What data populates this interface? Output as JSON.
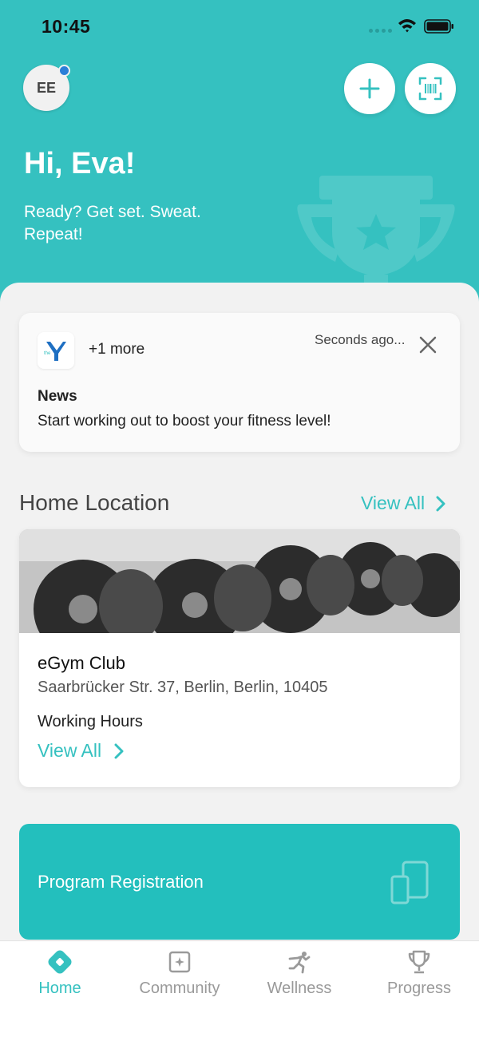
{
  "status_bar": {
    "time": "10:45"
  },
  "header": {
    "avatar_initials": "EE",
    "greeting": "Hi, Eva!",
    "tagline": "Ready? Get set. Sweat. Repeat!",
    "add_icon": "plus-icon",
    "scan_icon": "barcode-scan-icon"
  },
  "notification": {
    "logo_text": "the",
    "more": "+1 more",
    "time_ago": "Seconds ago...",
    "title": "News",
    "body": "Start working out to boost your fitness level!"
  },
  "home_location": {
    "section_title": "Home Location",
    "view_all": "View All",
    "club_name": "eGym Club",
    "address": "Saarbrücker Str. 37, Berlin, Berlin, 10405",
    "hours_label": "Working Hours",
    "hours_link": "View All"
  },
  "program": {
    "label": "Program Registration",
    "icon": "devices-icon"
  },
  "tabs": [
    {
      "label": "Home",
      "icon": "home-icon",
      "active": true
    },
    {
      "label": "Community",
      "icon": "community-icon",
      "active": false
    },
    {
      "label": "Wellness",
      "icon": "wellness-icon",
      "active": false
    },
    {
      "label": "Progress",
      "icon": "trophy-icon",
      "active": false
    }
  ],
  "colors": {
    "accent": "#35c1c0",
    "program_bg": "#23bfbd",
    "notification_dot": "#2b7fd8"
  }
}
